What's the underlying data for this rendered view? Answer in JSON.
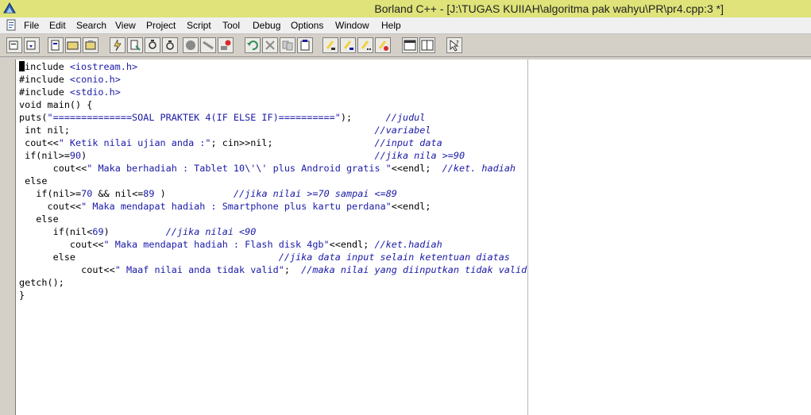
{
  "window": {
    "title": "Borland C++ - [J:\\TUGAS KUIIAH\\algoritma pak wahyu\\PR\\pr4.cpp:3 *]"
  },
  "menu": [
    "File",
    "Edit",
    "Search",
    "View",
    "Project",
    "Script",
    "Tool",
    "Debug",
    "Options",
    "Window",
    "Help"
  ],
  "toolbar": {
    "icons": [
      "new-project-icon",
      "open-project-icon",
      "compile-icon",
      "make-icon",
      "build-icon",
      "run-icon",
      "step-over-icon",
      "trace-into-icon",
      "breakpoint-icon",
      "watch-icon",
      "run-to-icon",
      "undo-icon",
      "cut-icon",
      "copy-icon",
      "paste-icon",
      "find-icon",
      "replace-icon",
      "search-again-icon",
      "browse-icon",
      "window-icon",
      "tile-icon",
      "help-icon"
    ]
  },
  "editor": {
    "lines": [
      [
        "",
        "#include <iostream.h>"
      ],
      [
        "",
        "#include <conio.h>"
      ],
      [
        "",
        "#include <stdio.h>"
      ],
      [
        "",
        "void main() {"
      ],
      [
        "",
        "puts(\"==============SOAL PRAKTEK 4(IF ELSE IF)==========\");      //judul"
      ],
      [
        "",
        " int nil;                                                      //variabel"
      ],
      [
        "",
        " cout<<\" Ketik nilai ujian anda :\"; cin>>nil;                  //input data"
      ],
      [
        "",
        " if(nil>=90)                                                   //jika nila >=90"
      ],
      [
        "",
        "      cout<<\" Maka berhadiah : Tablet 10\\'\\' plus Android gratis \"<<endl;  //ket. hadiah"
      ],
      [
        "",
        " else"
      ],
      [
        "",
        "   if(nil>=70 && nil<=89 )            //jika nilai >=70 sampai <=89"
      ],
      [
        "",
        "     cout<<\" Maka mendapat hadiah : Smartphone plus kartu perdana\"<<endl;"
      ],
      [
        "",
        "   else"
      ],
      [
        "",
        "      if(nil<69)          //jika nilai <90"
      ],
      [
        "",
        "         cout<<\" Maka mendapat hadiah : Flash disk 4gb\"<<endl; //ket.hadiah"
      ],
      [
        "",
        "      else                                    //jika data input selain ketentuan diatas"
      ],
      [
        "",
        "           cout<<\" Maaf nilai anda tidak valid\";  //maka nilai yang diinputkan tidak valid"
      ],
      [
        "",
        "getch();"
      ],
      [
        "",
        "}"
      ]
    ]
  }
}
